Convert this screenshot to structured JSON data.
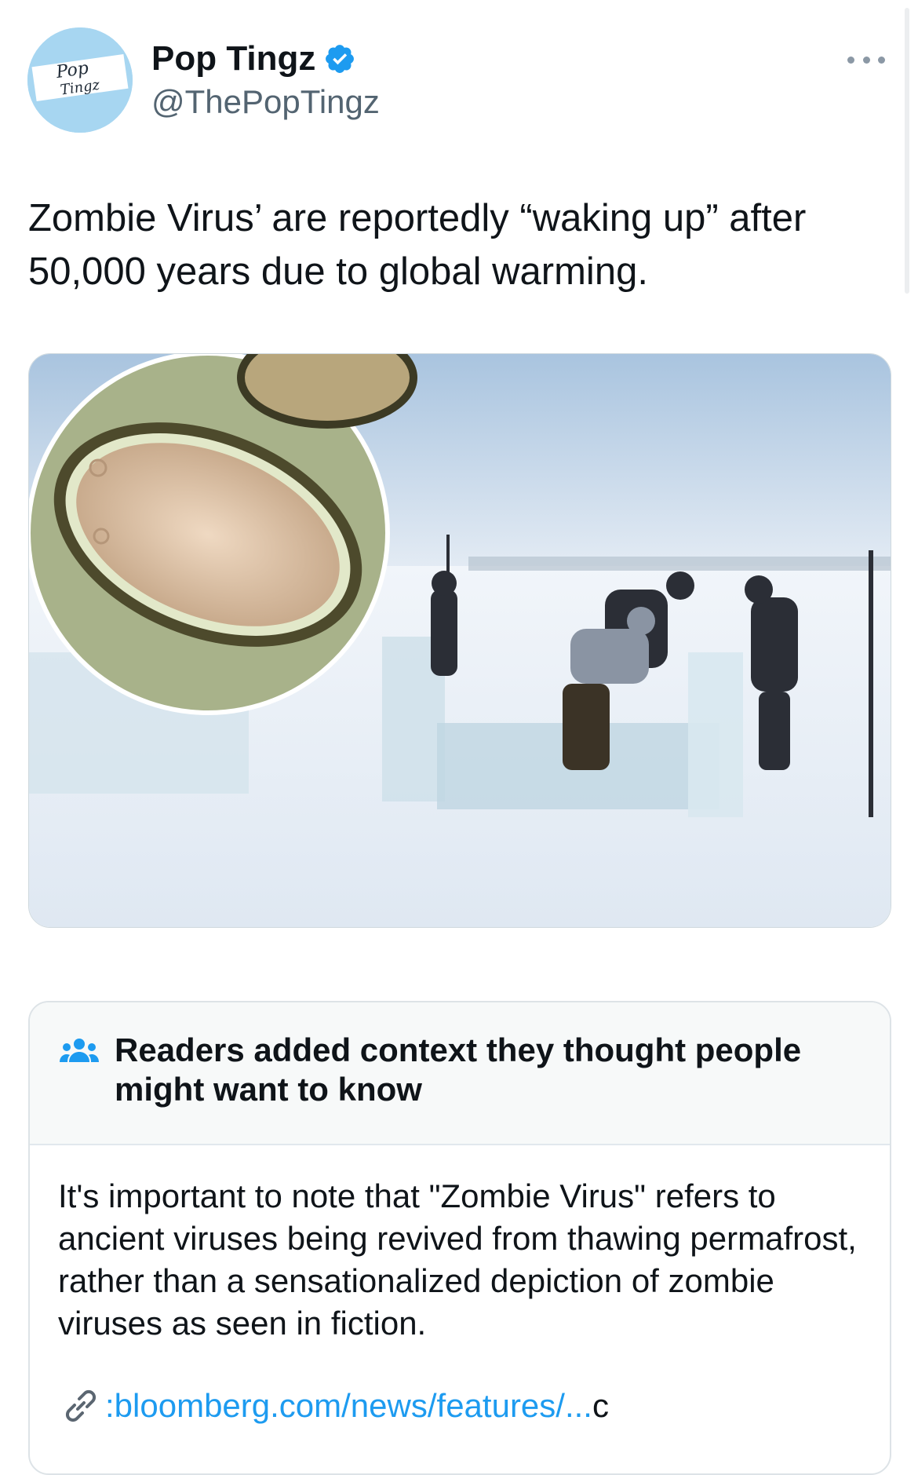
{
  "author": {
    "display_name": "Pop Tingz",
    "handle": "@ThePopTingz",
    "avatar_text_line1": "Pop",
    "avatar_text_line2": "Tingz",
    "verified": true
  },
  "tweet": {
    "text": "Zombie Virus’ are reportedly “waking up” after 50,000 years due to global warming."
  },
  "media": {
    "description_icon": "photo-icon"
  },
  "community_note": {
    "title": "Readers added context they thought people might want to know",
    "body": "It's important to note that \"Zombie Virus\" refers to ancient viruses being revived from thawing permafrost, rather than a sensationalized depiction of zombie viruses as seen in fiction.",
    "link_prefix": ":",
    "link_text": "bloomberg.com/news/features/...",
    "link_tail": "c"
  },
  "colors": {
    "accent": "#1d9bf0",
    "text": "#0f1419",
    "secondary_text": "#536471"
  }
}
